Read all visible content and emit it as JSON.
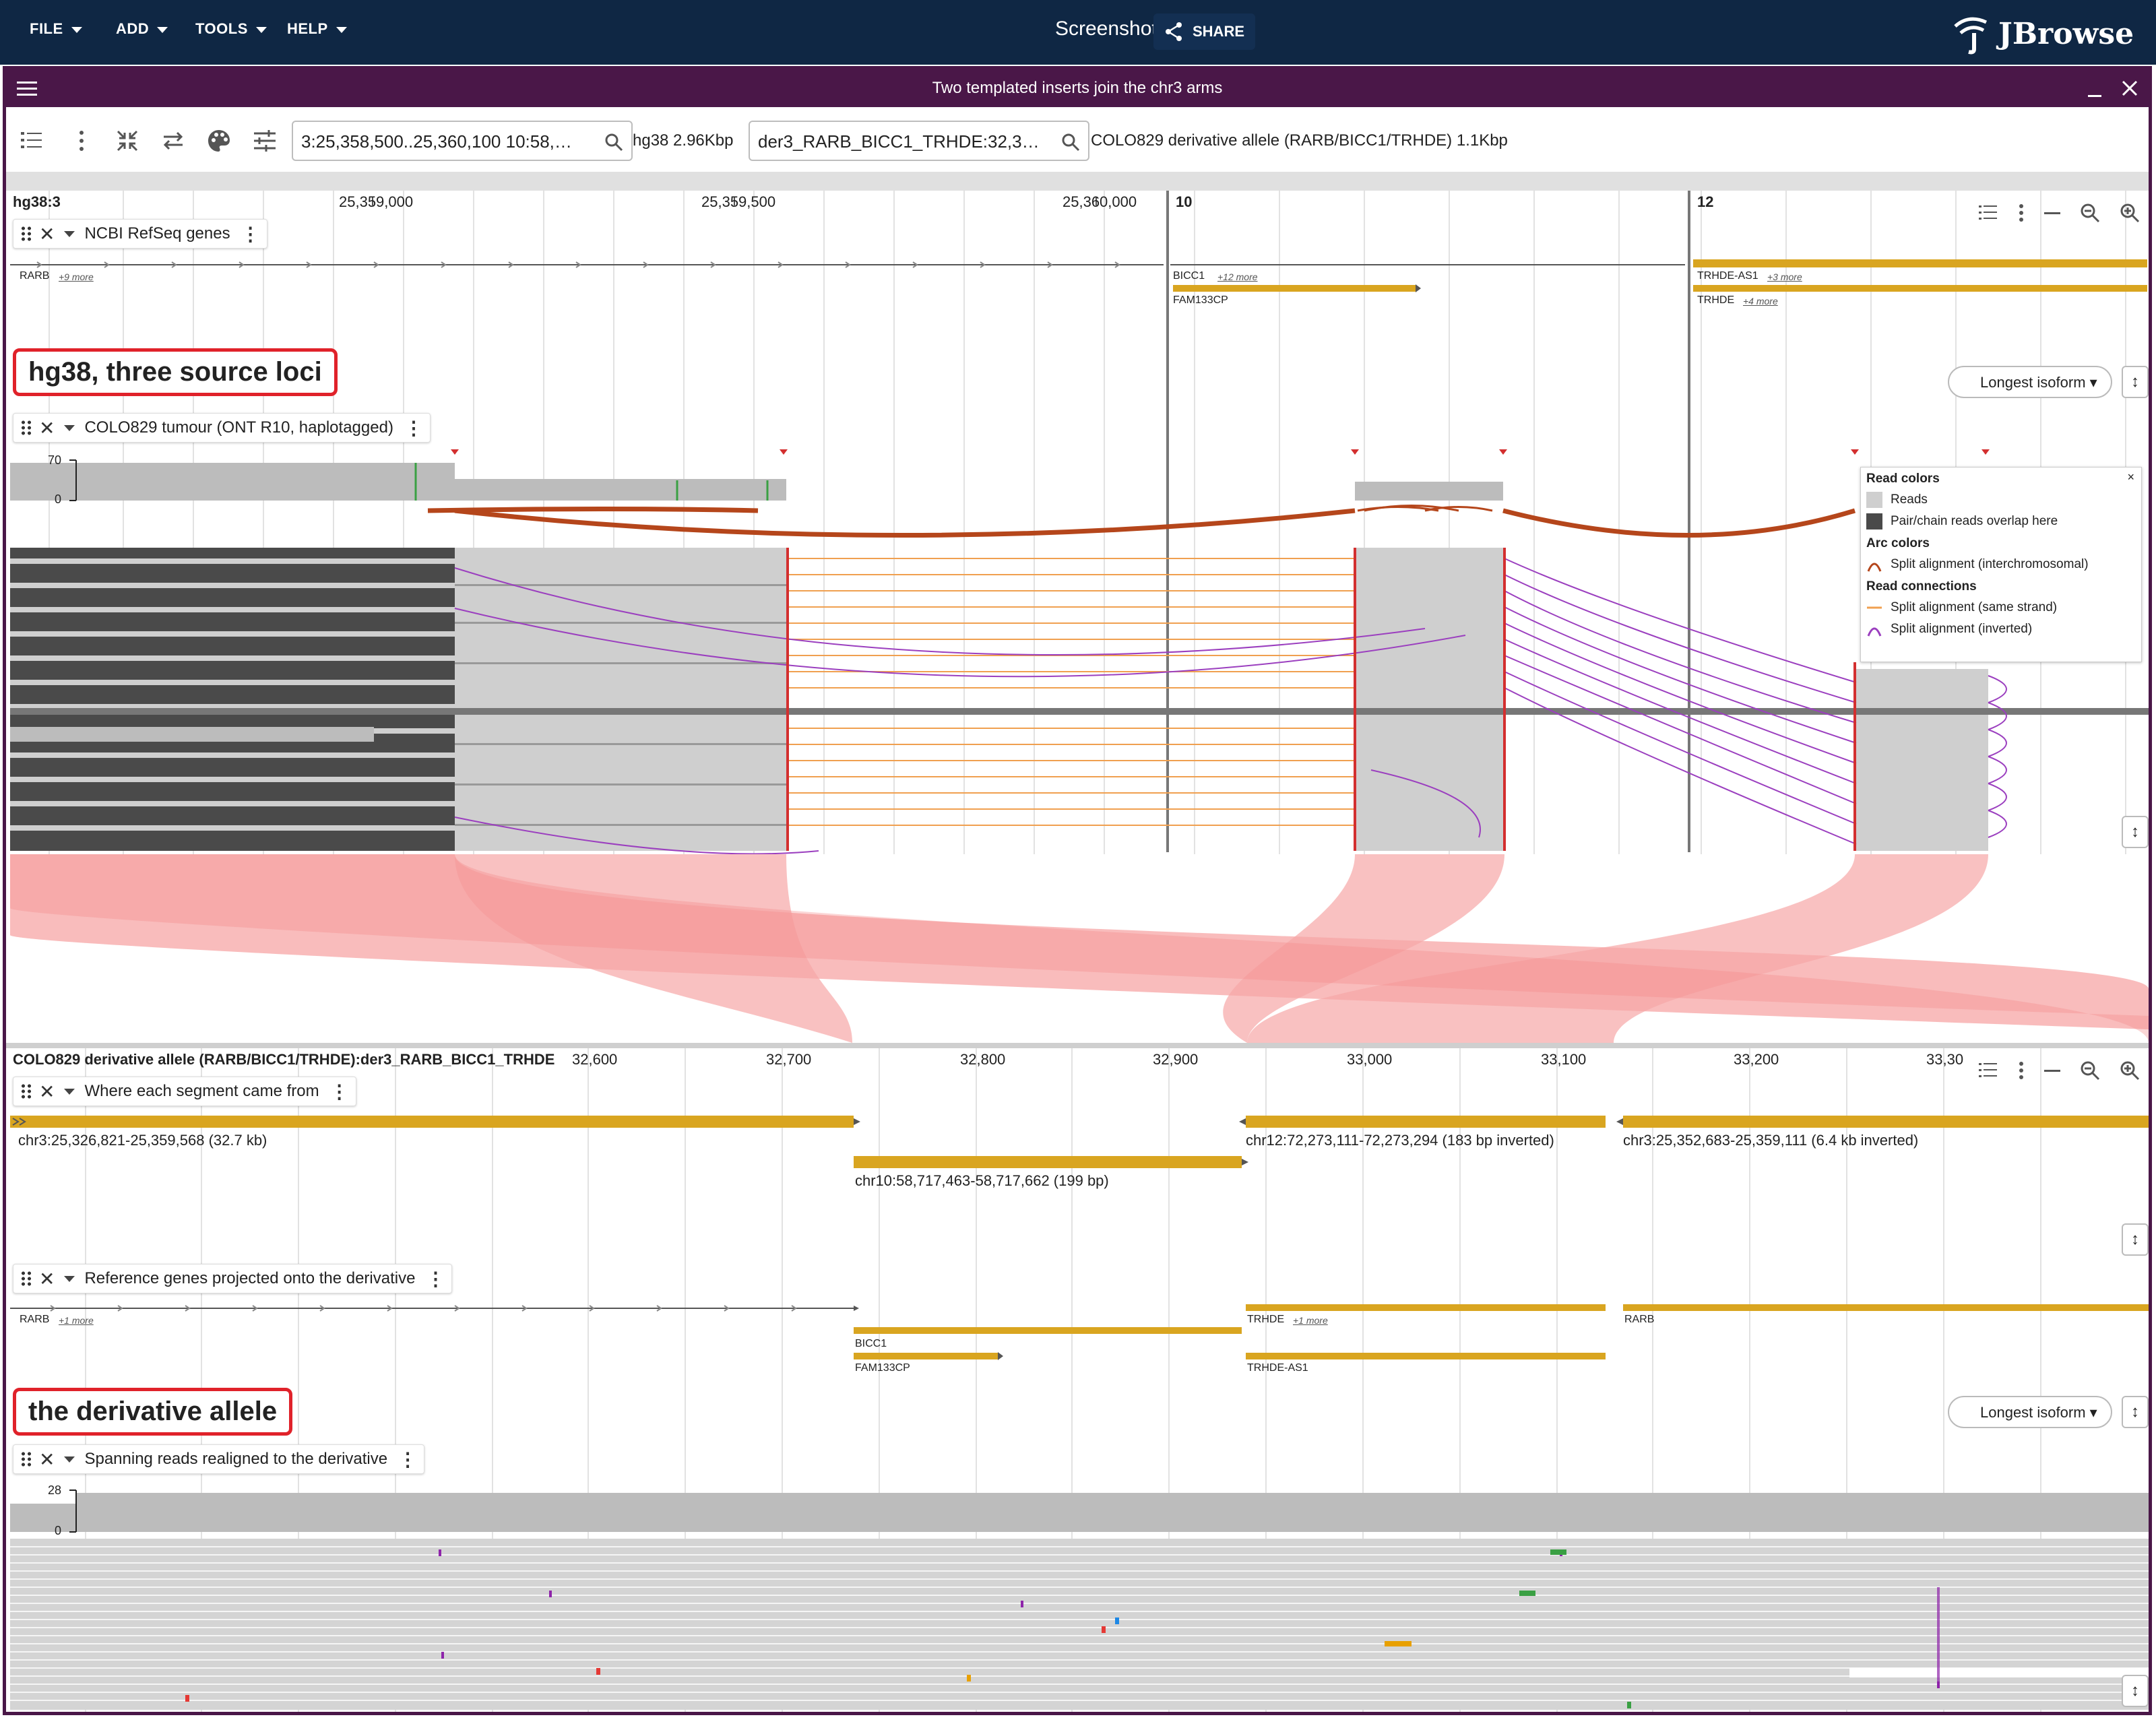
{
  "menu": {
    "file": "FILE",
    "add": "ADD",
    "tools": "TOOLS",
    "help": "HELP"
  },
  "header": {
    "screenshot": "Screenshot",
    "share": "SHARE",
    "brand": "JBrowse"
  },
  "view": {
    "title": "Two templated inserts join the chr3 arms"
  },
  "toolbar": {
    "loc1": "3:25,358,500..25,360,100 10:58,…",
    "asm1": "hg38 2.96Kbp",
    "loc2": "der3_RARB_BICC1_TRHDE:32,3…",
    "asm2": "COLO829 derivative allele (RARB/BICC1/TRHDE) 1.1Kbp"
  },
  "top": {
    "ruler": {
      "region": "hg38:3",
      "t1": "25,359,000",
      "t2": "25,359,500",
      "t3": "25,360,000",
      "chr10": "10",
      "chr12": "12"
    },
    "genes_track": "NCBI RefSeq genes",
    "genes": {
      "rarb": "RARB",
      "rarb_more": "+9 more",
      "bicc1": "BICC1",
      "bicc1_more": "+12 more",
      "fam133cp": "FAM133CP",
      "trhde_as1": "TRHDE-AS1",
      "trhde_as1_more": "+3 more",
      "trhde": "TRHDE",
      "trhde_more": "+4 more"
    },
    "callout": "hg38, three source loci",
    "isoform": "Longest isoform",
    "reads_track": "COLO829 tumour (ONT R10, haplotagged)",
    "cov_max": "70",
    "cov_min": "0"
  },
  "legend": {
    "read_colors": "Read colors",
    "reads": "Reads",
    "overlap": "Pair/chain reads overlap here",
    "arc_colors": "Arc colors",
    "interchrom": "Split alignment (interchromosomal)",
    "read_connections": "Read connections",
    "same_strand": "Split alignment (same strand)",
    "inverted": "Split alignment (inverted)",
    "close": "×"
  },
  "bottom": {
    "ruler": {
      "region": "COLO829 derivative allele (RARB/BICC1/TRHDE):der3_RARB_BICC1_TRHDE",
      "t1": "32,600",
      "t2": "32,700",
      "t3": "32,800",
      "t4": "32,900",
      "t5": "33,000",
      "t6": "33,100",
      "t7": "33,200",
      "t8": "33,30"
    },
    "segments_track": "Where each segment came from",
    "segments": {
      "s1": "chr3:25,326,821-25,359,568 (32.7 kb)",
      "s2": "chr10:58,717,463-58,717,662 (199 bp)",
      "s3": "chr12:72,273,111-72,273,294 (183 bp inverted)",
      "s4": "chr3:25,352,683-25,359,111 (6.4 kb inverted)"
    },
    "projected_track": "Reference genes projected onto the derivative",
    "genes": {
      "rarb": "RARB",
      "rarb_more": "+1 more",
      "bicc1": "BICC1",
      "fam133cp": "FAM133CP",
      "trhde": "TRHDE",
      "trhde_more": "+1 more",
      "trhde_as1": "TRHDE-AS1",
      "rarb2": "RARB"
    },
    "callout": "the derivative allele",
    "isoform": "Longest isoform",
    "reads_track": "Spanning reads realigned to the derivative",
    "cov_max": "28",
    "cov_min": "0"
  },
  "colors": {
    "appbar": "#0f2744",
    "viewbar": "#4a1748",
    "gene": "#d9a520",
    "arc": "#b5461b",
    "inverted": "#9b3fbf",
    "same_strand": "#f0a050",
    "synteny": "#f7a6a6"
  }
}
